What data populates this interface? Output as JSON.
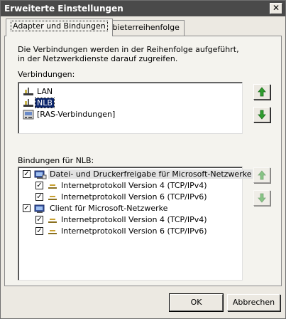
{
  "window": {
    "title": "Erweiterte Einstellungen",
    "close_label": "✕"
  },
  "tabs": [
    {
      "label": "Adapter und Bindungen",
      "active": true
    },
    {
      "label": "Anbieterreihenfolge",
      "active": false
    }
  ],
  "description": "Die Verbindungen werden in der Reihenfolge aufgeführt, in der Netzwerkdienste darauf zugreifen.",
  "connections": {
    "label": "Verbindungen:",
    "items": [
      {
        "label": "LAN",
        "icon": "network-adapter-icon",
        "selected": false
      },
      {
        "label": "NLB",
        "icon": "network-adapter-icon",
        "selected": true
      },
      {
        "label": "[RAS-Verbindungen]",
        "icon": "ras-connection-icon",
        "selected": false
      }
    ]
  },
  "bindings": {
    "label": "Bindungen für NLB:",
    "items": [
      {
        "label": "Datei- und Druckerfreigabe für Microsoft-Netzwerke",
        "checked": true,
        "level": 0,
        "icon": "file-printer-sharing-icon"
      },
      {
        "label": "Internetprotokoll Version 4 (TCP/IPv4)",
        "checked": true,
        "level": 1,
        "icon": "protocol-icon"
      },
      {
        "label": "Internetprotokoll Version 6 (TCP/IPv6)",
        "checked": true,
        "level": 1,
        "icon": "protocol-icon"
      },
      {
        "label": "Client für Microsoft-Netzwerke",
        "checked": true,
        "level": 0,
        "icon": "network-client-icon"
      },
      {
        "label": "Internetprotokoll Version 4 (TCP/IPv4)",
        "checked": true,
        "level": 1,
        "icon": "protocol-icon"
      },
      {
        "label": "Internetprotokoll Version 6 (TCP/IPv6)",
        "checked": true,
        "level": 1,
        "icon": "protocol-icon"
      }
    ]
  },
  "buttons": {
    "ok": "OK",
    "cancel": "Abbrechen"
  },
  "colors": {
    "selection": "#0a246a",
    "arrow_green": "#2e9e2e",
    "titlebar": "#4a4a4a"
  }
}
